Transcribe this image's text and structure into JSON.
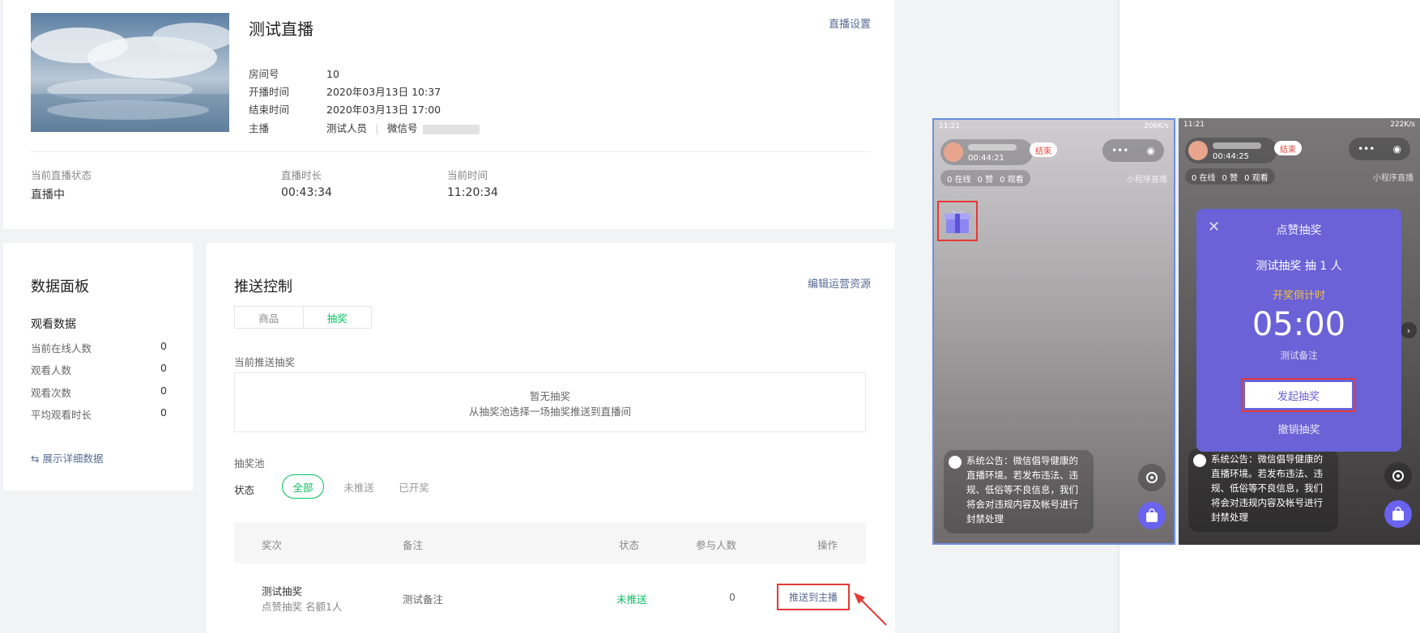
{
  "live": {
    "title": "测试直播",
    "settings_link": "直播设置",
    "room_label": "房间号",
    "room_value": "10",
    "start_label": "开播时间",
    "start_value": "2020年03月13日 10:37",
    "end_label": "结束时间",
    "end_value": "2020年03月13日 17:00",
    "host_label": "主播",
    "host_value": "测试人员",
    "wechat_label": "微信号",
    "status_label": "当前直播状态",
    "status_value": "直播中",
    "duration_label": "直播时长",
    "duration_value": "00:43:34",
    "time_label": "当前时间",
    "time_value": "11:20:34"
  },
  "data_panel": {
    "title": "数据面板",
    "section": "观看数据",
    "rows": [
      {
        "label": "当前在线人数",
        "value": "0"
      },
      {
        "label": "观看人数",
        "value": "0"
      },
      {
        "label": "观看次数",
        "value": "0"
      },
      {
        "label": "平均观看时长",
        "value": "0"
      }
    ],
    "detail_link": "⇆ 展示详细数据"
  },
  "push": {
    "title": "推送控制",
    "edit_link": "编辑运营资源",
    "tabs": [
      "商品",
      "抽奖"
    ],
    "current_label": "当前推送抽奖",
    "empty_title": "暂无抽奖",
    "empty_desc": "从抽奖池选择一场抽奖推送到直播间",
    "pool_label": "抽奖池",
    "status_label": "状态",
    "filters": [
      "全部",
      "未推送",
      "已开奖"
    ],
    "columns": [
      "奖次",
      "备注",
      "状态",
      "参与人数",
      "操作"
    ],
    "row": {
      "name": "测试抽奖",
      "sub": "点赞抽奖 名额1人",
      "remark": "测试备注",
      "status": "未推送",
      "count": "0",
      "action": "推送到主播"
    }
  },
  "phone1": {
    "time": "11:21",
    "net": "206K/s",
    "duration": "00:44:21",
    "end_tag": "结束",
    "counts": [
      "0 在线",
      "0 赞",
      "0 观看"
    ],
    "mini": "小程序直播",
    "notice": "系统公告：微信倡导健康的直播环境。若发布违法、违规、低俗等不良信息，我们将会对违规内容及帐号进行封禁处理"
  },
  "phone2": {
    "time": "11:21",
    "net": "222K/s",
    "duration": "00:44:25",
    "end_tag": "结束",
    "counts": [
      "0 在线",
      "0 赞",
      "0 观看"
    ],
    "mini": "小程序直播",
    "notice": "系统公告：微信倡导健康的直播环境。若发布违法、违规、低俗等不良信息，我们将会对违规内容及帐号进行封禁处理",
    "modal": {
      "title": "点赞抽奖",
      "name": "测试抽奖  抽 1 人",
      "countdown_label": "开奖倒计时",
      "countdown": "05:00",
      "remark": "测试备注",
      "start": "发起抽奖",
      "cancel": "撤销抽奖"
    }
  },
  "colors": {
    "accent": "#07c160",
    "link": "#576b95",
    "highlight": "#e53935",
    "modal": "#6a62d6"
  }
}
